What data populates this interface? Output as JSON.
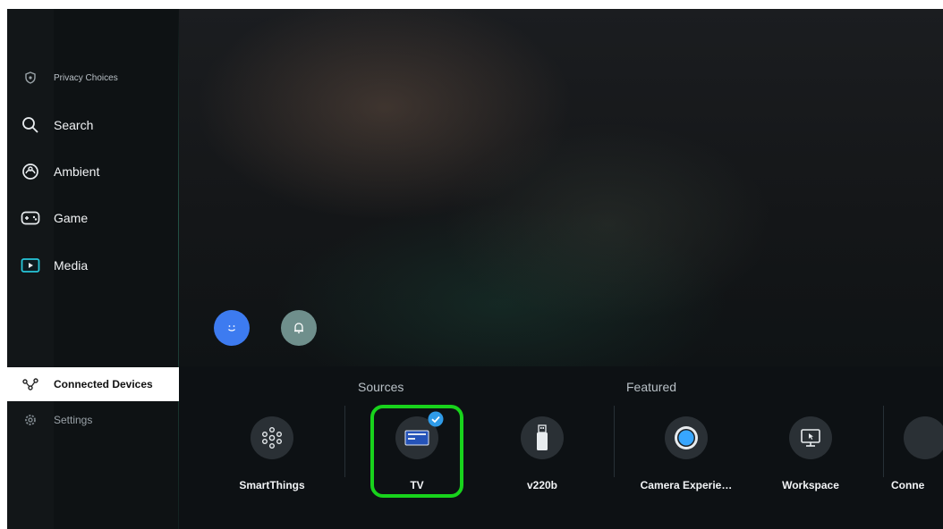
{
  "sidebar": {
    "items": [
      {
        "label": "Privacy Choices",
        "icon": "shield-icon"
      },
      {
        "label": "Search",
        "icon": "search-icon"
      },
      {
        "label": "Ambient",
        "icon": "ambient-icon"
      },
      {
        "label": "Game",
        "icon": "gamepad-icon"
      },
      {
        "label": "Media",
        "icon": "media-icon"
      },
      {
        "label": "Connected Devices",
        "icon": "connected-devices-icon"
      },
      {
        "label": "Settings",
        "icon": "gear-icon"
      }
    ]
  },
  "quick_buttons": [
    {
      "icon": "smiley-icon",
      "color": "#3d7bf0"
    },
    {
      "icon": "bell-icon",
      "color": "#6f8f8c"
    }
  ],
  "sections": {
    "sources_title": "Sources",
    "featured_title": "Featured"
  },
  "tiles": [
    {
      "label": "SmartThings",
      "icon": "smartthings-icon"
    },
    {
      "label": "TV",
      "icon": "tv-icon",
      "selected": true
    },
    {
      "label": "v220b",
      "icon": "usb-icon"
    },
    {
      "label": "Camera Experie…",
      "icon": "camera-icon"
    },
    {
      "label": "Workspace",
      "icon": "workspace-icon"
    },
    {
      "label": "Conne",
      "icon": "connection-icon"
    }
  ],
  "colors": {
    "focus": "#18d31c",
    "check_badge": "#2f9be8",
    "camera_blue": "#37a6ff"
  }
}
